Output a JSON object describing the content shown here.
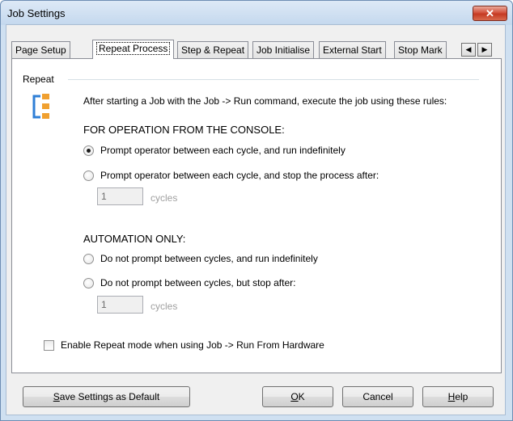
{
  "window": {
    "title": "Job Settings",
    "close_glyph": "✕"
  },
  "tabs": [
    {
      "label": "Page Setup"
    },
    {
      "label": "Repeat Process",
      "active": true
    },
    {
      "label": "Step & Repeat"
    },
    {
      "label": "Job Initialise"
    },
    {
      "label": "External Start"
    },
    {
      "label": "Stop Mark"
    }
  ],
  "tab_scroll": {
    "left_glyph": "◀",
    "right_glyph": "▶"
  },
  "repeat_group": {
    "label": "Repeat",
    "icon": "repeat-icon",
    "intro": "After starting a Job with the Job -> Run command, execute the job using these rules:",
    "console_heading": "FOR OPERATION FROM THE CONSOLE:",
    "console_options": [
      {
        "label": "Prompt operator between each cycle, and run indefinitely",
        "checked": true
      },
      {
        "label": "Prompt operator between each cycle, and stop the process after:",
        "checked": false
      }
    ],
    "console_cycles": {
      "value": "1",
      "unit": "cycles"
    },
    "automation_heading": "AUTOMATION ONLY:",
    "automation_options": [
      {
        "label": "Do not prompt between cycles, and run indefinitely",
        "checked": false
      },
      {
        "label": "Do not prompt between cycles, but stop after:",
        "checked": false
      }
    ],
    "automation_cycles": {
      "value": "1",
      "unit": "cycles"
    },
    "hardware_checkbox": {
      "label": "Enable Repeat mode when using Job -> Run From Hardware",
      "checked": false
    }
  },
  "buttons": {
    "save_default": {
      "mnemonic": "S",
      "rest": "ave Settings as Default"
    },
    "ok": {
      "mnemonic": "O",
      "rest": "K"
    },
    "cancel": {
      "label": "Cancel"
    },
    "help": {
      "mnemonic": "H",
      "rest": "elp"
    }
  },
  "colors": {
    "titlebar": "#c4d8ee",
    "close": "#c53a22",
    "icon_orange": "#f0a030",
    "icon_blue": "#2f7fd6"
  }
}
